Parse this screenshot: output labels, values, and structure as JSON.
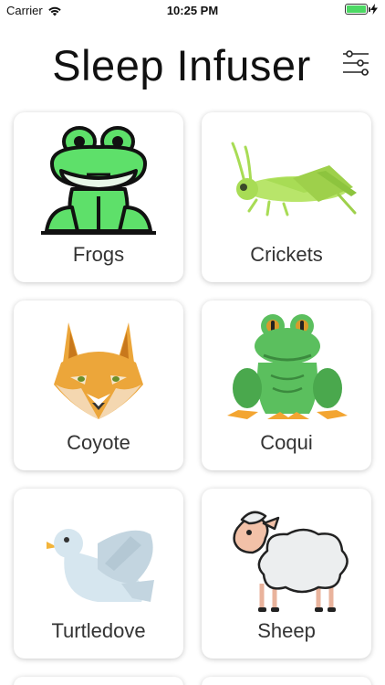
{
  "status_bar": {
    "carrier": "Carrier",
    "time": "10:25 PM",
    "battery_level": 1.0
  },
  "header": {
    "title": "Sleep Infuser",
    "filter_icon": "sliders-icon"
  },
  "sounds": [
    {
      "label": "Frogs",
      "icon": "frog-cartoon-icon"
    },
    {
      "label": "Crickets",
      "icon": "cricket-icon"
    },
    {
      "label": "Coyote",
      "icon": "coyote-icon"
    },
    {
      "label": "Coqui",
      "icon": "coqui-frog-icon"
    },
    {
      "label": "Turtledove",
      "icon": "dove-icon"
    },
    {
      "label": "Sheep",
      "icon": "sheep-icon"
    }
  ],
  "colors": {
    "frog_green": "#5ee06a",
    "cricket_green": "#a8dc55",
    "coyote_orange": "#eca63a",
    "coqui_green": "#5bbf5e",
    "dove_blue": "#d6e6ef"
  }
}
